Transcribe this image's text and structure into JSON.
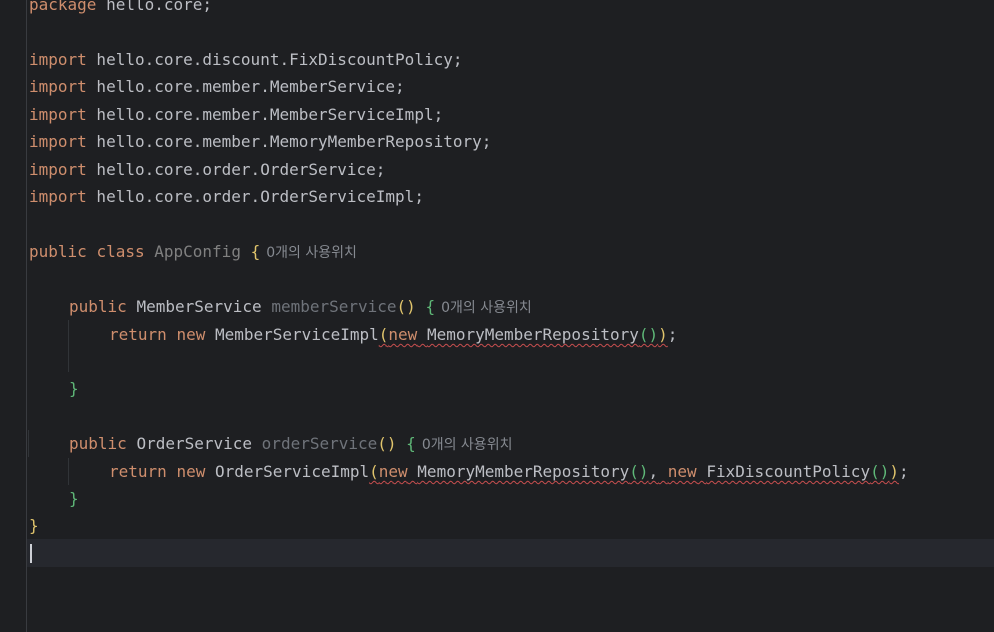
{
  "code": {
    "line_package": {
      "kw": "package",
      "rest": " hello.core;"
    },
    "imports": [
      {
        "kw": "import",
        "path": " hello.core.discount.FixDiscountPolicy;"
      },
      {
        "kw": "import",
        "path": " hello.core.member.MemberService;"
      },
      {
        "kw": "import",
        "path": " hello.core.member.MemberServiceImpl;"
      },
      {
        "kw": "import",
        "path": " hello.core.member.MemoryMemberRepository;"
      },
      {
        "kw": "import",
        "path": " hello.core.order.OrderService;"
      },
      {
        "kw": "import",
        "path": " hello.core.order.OrderServiceImpl;"
      }
    ],
    "class_decl": {
      "kw_public": "public",
      "kw_class": "class",
      "name": "AppConfig",
      "open_brace": "{",
      "usage_hint": "0개의 사용위치"
    },
    "member_method": {
      "kw_public": "public",
      "return_type": "MemberService",
      "name": "memberService",
      "parens": "()",
      "open_brace": "{",
      "usage_hint": "0개의 사용위치",
      "return_kw": "return",
      "new_kw": "new",
      "impl": "MemberServiceImpl",
      "paren_open": "(",
      "arg_new": "new",
      "arg_type": "MemoryMemberRepository",
      "arg_parens": "()",
      "paren_close": ")",
      "semicolon": ";",
      "close_brace": "}"
    },
    "order_method": {
      "kw_public": "public",
      "return_type": "OrderService",
      "name": "orderService",
      "parens": "()",
      "open_brace": "{",
      "usage_hint": "0개의 사용위치",
      "return_kw": "return",
      "new_kw": "new",
      "impl": "OrderServiceImpl",
      "paren_open": "(",
      "arg1_new": "new",
      "arg1_type": "MemoryMemberRepository",
      "arg1_parens": "()",
      "comma": ",",
      "arg2_new": "new",
      "arg2_type": "FixDiscountPolicy",
      "arg2_parens": "()",
      "paren_close": ")",
      "semicolon": ";",
      "close_brace": "}"
    },
    "class_close_brace": "}"
  },
  "colors": {
    "background": "#1e1f22",
    "keyword": "#cf8e6d",
    "text": "#bcbec4",
    "class_name_unused": "#808080",
    "method_unused": "#6f737a",
    "brace_class": "#e0c46c",
    "brace_method": "#5fb878",
    "error_squiggle": "#c94f4f",
    "hint": "#868a91"
  }
}
